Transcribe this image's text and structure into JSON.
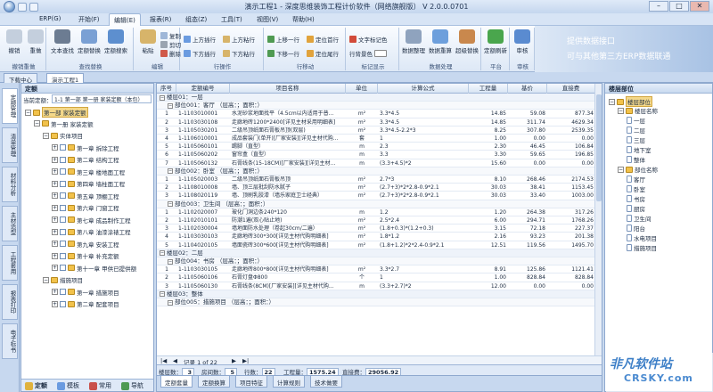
{
  "window": {
    "title": "演示工程1 - 深度思维装饰工程计价软件（网络旗舰版） V 2.0.0.0701",
    "min": "–",
    "max": "□",
    "close": "✕"
  },
  "menu": [
    "ERP(G)",
    "开始(F)",
    "编辑(E)",
    "报表(R)",
    "组态(Z)",
    "工具(T)",
    "视图(V)",
    "帮助(H)"
  ],
  "ribbon": {
    "groups": [
      {
        "label": "撤销重做",
        "buttons": [
          "撤销",
          "重做"
        ]
      },
      {
        "label": "查找替换",
        "buttons": [
          "文本查找",
          "定额替换",
          "定额搜索"
        ]
      },
      {
        "label": "编辑",
        "buttons": [
          "粘贴"
        ],
        "small": [
          "复制",
          "剪切",
          "删除"
        ]
      },
      {
        "label": "行操作",
        "small": [
          "上方插行",
          "下方插行",
          "上方粘行",
          "下方粘行"
        ]
      },
      {
        "label": "行移动",
        "small": [
          "上移一行",
          "下移一行",
          "定位首行",
          "定位尾行"
        ]
      },
      {
        "label": "标记显示",
        "small": [
          "文字标记色",
          "行背景色"
        ]
      },
      {
        "label": "数据处理",
        "buttons": [
          "数据整理",
          "数据重算",
          "超级替换"
        ]
      },
      {
        "label": "平台",
        "buttons": [
          "定额刷新"
        ]
      },
      {
        "label": "审核",
        "buttons": [
          "审核"
        ]
      }
    ],
    "promo_line1": "提供数据接口",
    "promo_line2": "可与其他第三方ERP数据联通"
  },
  "doc_tabs": [
    "下载中心",
    "演示工程1"
  ],
  "side_tabs": [
    "定额管理",
    "清单管理",
    "材料分析",
    "主材造型",
    "工程套用",
    "报表打印",
    "电子标书"
  ],
  "left": {
    "title": "定额",
    "filter_label": "当前定额：",
    "filter_value": "1-1 第一部 第一册 家装定额（本包）",
    "tree": [
      {
        "text": "第一部 家装定额",
        "level": 0,
        "expanded": true,
        "selected": true
      },
      {
        "text": "第一册 家装定额",
        "level": 1,
        "expanded": true
      },
      {
        "text": "实体项目",
        "level": 2,
        "expanded": true
      },
      {
        "text": "第一章 拆除工程",
        "level": 3
      },
      {
        "text": "第二章 结构工程",
        "level": 3
      },
      {
        "text": "第三章 楼地面工程",
        "level": 3
      },
      {
        "text": "第四章 墙柱面工程",
        "level": 3
      },
      {
        "text": "第五章 顶棚工程",
        "level": 3
      },
      {
        "text": "第六章 门窗工程",
        "level": 3
      },
      {
        "text": "第七章 成品制作工程",
        "level": 3
      },
      {
        "text": "第八章 油漆涂裱工程",
        "level": 3
      },
      {
        "text": "第九章 安装工程",
        "level": 3
      },
      {
        "text": "第十章 补充定额",
        "level": 3
      },
      {
        "text": "第十一章 甲供已提供额",
        "level": 3
      },
      {
        "text": "措施项目",
        "level": 2,
        "expanded": true
      },
      {
        "text": "第一章 措施项目",
        "level": 3
      },
      {
        "text": "第二章 配套项目",
        "level": 3
      }
    ],
    "bottom_tabs": [
      "定额",
      "模板",
      "常用",
      "导航"
    ]
  },
  "grid": {
    "headers": [
      "序号",
      "定额编号",
      "项目名称",
      "单位",
      "计算公式",
      "工程量",
      "基价",
      "直接费"
    ],
    "rows": [
      {
        "type": "g1",
        "text": "楼层01：一层"
      },
      {
        "type": "g2",
        "text": "部位001：客厅 （层高：；面积：）"
      },
      {
        "n": "1",
        "code": "1-1103010001",
        "name": "水泥砂浆地面找平（4.5cm以内适用于普...",
        "unit": "m²",
        "formula": "3.3*4.5",
        "qty": "14.85",
        "price": "59.08",
        "total": "877.34"
      },
      {
        "n": "2",
        "code": "1-1103030108",
        "name": "走廊地砖1200*2400[详见主材采用明细表]",
        "unit": "m²",
        "formula": "3.3*4.5",
        "qty": "14.85",
        "price": "311.74",
        "total": "4629.34"
      },
      {
        "n": "3",
        "code": "1-1105030201",
        "name": "二级吊顶纸面石膏板吊顶(双层)",
        "unit": "m²",
        "formula": "3.3*4.5-2.2*3",
        "qty": "8.25",
        "price": "307.80",
        "total": "2539.35"
      },
      {
        "n": "4",
        "code": "1-1106010001",
        "name": "成品套装门(单开)[厂家安装][详见主材代购...",
        "unit": "套",
        "formula": "1",
        "qty": "1.00",
        "price": "0.00",
        "total": "0.00"
      },
      {
        "n": "5",
        "code": "1-1105060101",
        "name": "踢脚（直型）",
        "unit": "m",
        "formula": "2.3",
        "qty": "2.30",
        "price": "46.45",
        "total": "106.84"
      },
      {
        "n": "6",
        "code": "1-1105060202",
        "name": "窗帘盒（直型）",
        "unit": "m",
        "formula": "3.3",
        "qty": "3.30",
        "price": "59.65",
        "total": "196.85"
      },
      {
        "n": "7",
        "code": "1-1105060132",
        "name": "石膏线条(15-18CM)[厂家安装][详见主材...",
        "unit": "m",
        "formula": "(3.3+4.5)*2",
        "qty": "15.60",
        "price": "0.00",
        "total": "0.00"
      },
      {
        "type": "g2",
        "text": "部位002：卧室 （层高：；面积：）"
      },
      {
        "n": "1",
        "code": "1-1105020003",
        "name": "二级吊顶纸面石膏板吊顶",
        "unit": "m²",
        "formula": "2.7*3",
        "qty": "8.10",
        "price": "268.46",
        "total": "2174.53"
      },
      {
        "n": "2",
        "code": "1-1108010008",
        "name": "墙、顶三层批刮防水腻子",
        "unit": "m²",
        "formula": "(2.7+3)*2*2.8-0.9*2.1",
        "qty": "30.03",
        "price": "38.41",
        "total": "1153.45"
      },
      {
        "n": "3",
        "code": "1-1108020119",
        "name": "墙、顶刷乳胶漆（墙乐家庭卫士经典）",
        "unit": "m²",
        "formula": "(2.7+3)*2*2.8-0.9*2.1",
        "qty": "30.03",
        "price": "33.40",
        "total": "1003.00"
      },
      {
        "type": "g2",
        "text": "部位003：卫生间 （层高：；面积：）"
      },
      {
        "n": "1",
        "code": "1-1102020007",
        "name": "玻化门洞边条240*120",
        "unit": "m",
        "formula": "1.2",
        "qty": "1.20",
        "price": "264.38",
        "total": "317.26"
      },
      {
        "n": "2",
        "code": "1-1102010101",
        "name": "防潮1遍(双心贴止地)",
        "unit": "m²",
        "formula": "2.5*2.4",
        "qty": "6.00",
        "price": "294.71",
        "total": "1768.26"
      },
      {
        "n": "3",
        "code": "1-1102030004",
        "name": "墙地面防水处理（卷起30cm/二遍）",
        "unit": "m²",
        "formula": "(1.8+0.3)*(1.2+0.3)",
        "qty": "3.15",
        "price": "72.18",
        "total": "227.37"
      },
      {
        "n": "4",
        "code": "1-1103030103",
        "name": "走廊地砖300*300[详见主材代购明细表]",
        "unit": "m²",
        "formula": "1.8*1.2",
        "qty": "2.16",
        "price": "93.23",
        "total": "201.38"
      },
      {
        "n": "5",
        "code": "1-1104020105",
        "name": "墙面瓷砖300*600[详见主材代购明细表]",
        "unit": "m²",
        "formula": "(1.8+1.2)*2*2.4-0.9*2.1",
        "qty": "12.51",
        "price": "119.56",
        "total": "1495.70"
      },
      {
        "type": "g1",
        "text": "楼层02：二层"
      },
      {
        "type": "g2",
        "text": "部位004：书房 （层高：；面积：）"
      },
      {
        "n": "1",
        "code": "1-1103030105",
        "name": "走廊地砖800*800[详见主材代购明细表]",
        "unit": "m²",
        "formula": "3.3*2.7",
        "qty": "8.91",
        "price": "125.86",
        "total": "1121.41"
      },
      {
        "n": "2",
        "code": "1-1105060106",
        "name": "石膏灯盘Φ800",
        "unit": "个",
        "formula": "1",
        "qty": "1.00",
        "price": "828.84",
        "total": "828.84"
      },
      {
        "n": "3",
        "code": "1-1105060130",
        "name": "石膏线条(8CM)[厂家安装][详见主材代购...",
        "unit": "m",
        "formula": "(3.3+2.7)*2",
        "qty": "12.00",
        "price": "0.00",
        "total": "0.00"
      },
      {
        "type": "g1",
        "text": "楼层03：整体"
      },
      {
        "type": "g2",
        "text": "部位005：措施项目 （层高：；面积：）"
      }
    ],
    "nav": "记录 1 of 22"
  },
  "stats": [
    {
      "label": "楼层数：",
      "value": "3"
    },
    {
      "label": "房间数：",
      "value": "5"
    },
    {
      "label": "行数：",
      "value": "22"
    },
    {
      "label": "工程量：",
      "value": "1575.24"
    },
    {
      "label": "直接费：",
      "value": "29056.92"
    }
  ],
  "bottom_tabs": [
    "定额套量",
    "定额换算",
    "项目特征",
    "计算规则",
    "技术做要"
  ],
  "right": {
    "title": "楼层部位",
    "tree": [
      {
        "text": "楼层部位",
        "level": 0,
        "selected": true
      },
      {
        "text": "楼层名称",
        "level": 1
      },
      {
        "text": "一层",
        "level": 2
      },
      {
        "text": "二层",
        "level": 2
      },
      {
        "text": "三层",
        "level": 2
      },
      {
        "text": "地下室",
        "level": 2
      },
      {
        "text": "整体",
        "level": 2
      },
      {
        "text": "部位名称",
        "level": 1
      },
      {
        "text": "客厅",
        "level": 2
      },
      {
        "text": "卧室",
        "level": 2
      },
      {
        "text": "书房",
        "level": 2
      },
      {
        "text": "厨房",
        "level": 2
      },
      {
        "text": "卫生间",
        "level": 2
      },
      {
        "text": "阳台",
        "level": 2
      },
      {
        "text": "水电项目",
        "level": 2
      },
      {
        "text": "措施项目",
        "level": 2
      }
    ]
  },
  "watermark": {
    "line1": "非凡软件站",
    "line2": "CRSKY.com"
  },
  "colors": {
    "accent": "#4a7fc0",
    "ribbon_bg": "#dde8f6",
    "selected": "#f4d88a",
    "group_row": "#eef3fa"
  }
}
